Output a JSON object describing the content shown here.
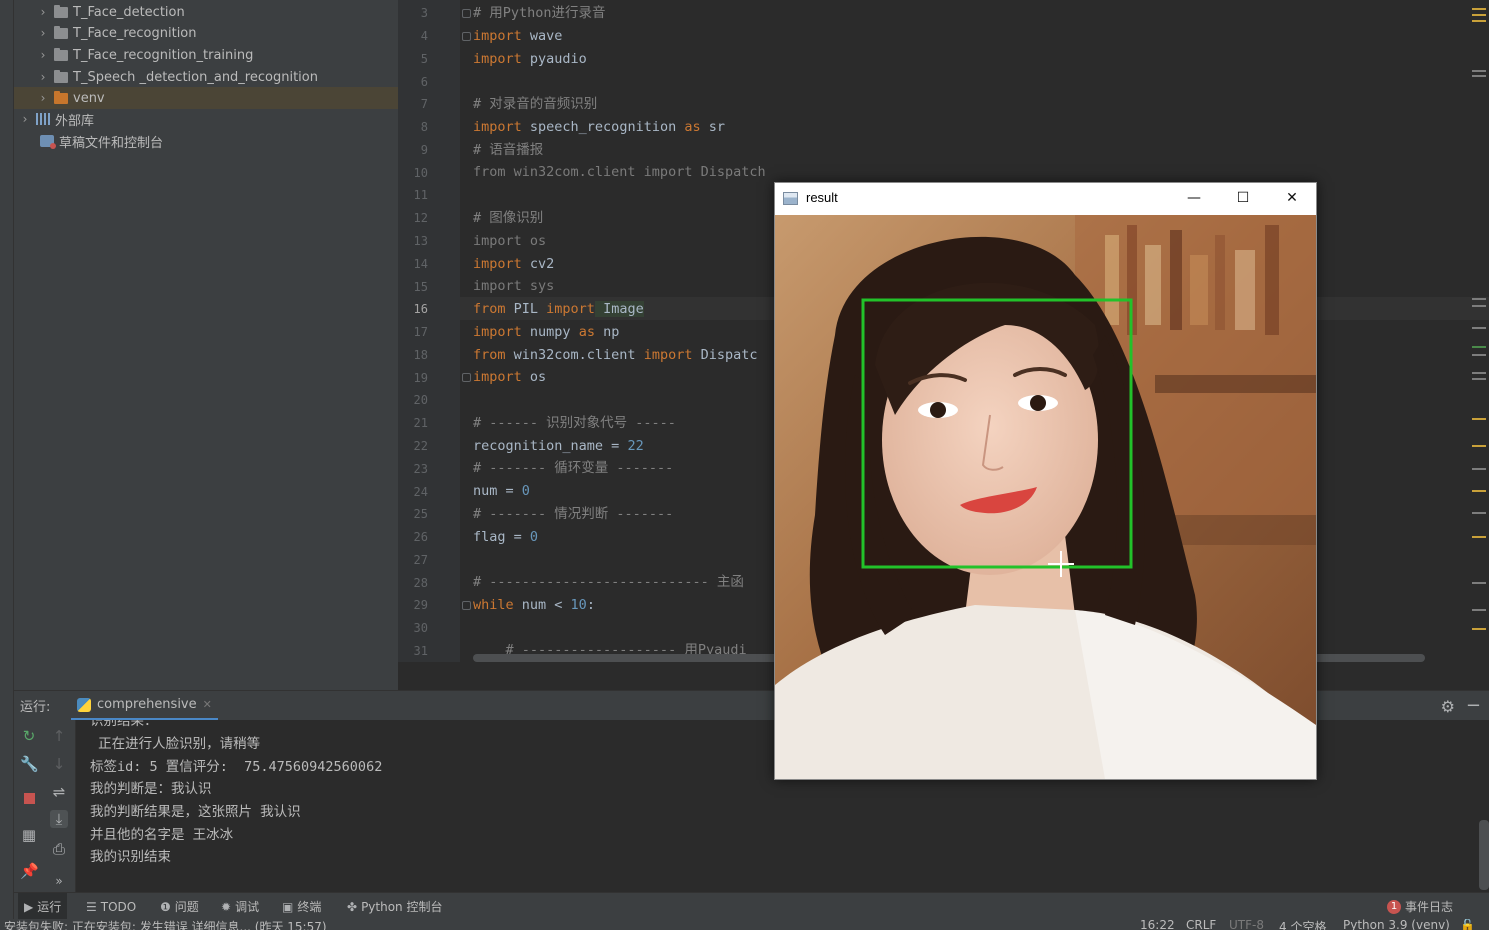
{
  "project_tree": {
    "items": [
      {
        "label": "T_Face_detection",
        "icon": "folder-icon"
      },
      {
        "label": "T_Face_recognition",
        "icon": "folder-icon"
      },
      {
        "label": "T_Face_recognition_training",
        "icon": "folder-icon"
      },
      {
        "label": "T_Speech _detection_and_recognition",
        "icon": "folder-icon"
      },
      {
        "label": "venv",
        "icon": "folder-orange-icon"
      },
      {
        "label": "外部库",
        "icon": "library-icon"
      },
      {
        "label": "草稿文件和控制台",
        "icon": "scratches-icon"
      }
    ]
  },
  "editor": {
    "line_numbers": [
      "3",
      "4",
      "5",
      "6",
      "7",
      "8",
      "9",
      "10",
      "11",
      "12",
      "13",
      "14",
      "15",
      "16",
      "17",
      "18",
      "19",
      "20",
      "21",
      "22",
      "23",
      "24",
      "25",
      "26",
      "27",
      "28",
      "29",
      "30",
      "31"
    ],
    "current_line": "16",
    "lines": {
      "l3": "# 用Python进行录音",
      "l4a": "import",
      "l4b": " wave",
      "l5a": "import",
      "l5b": " pyaudio",
      "l7": "# 对录音的音频识别",
      "l8a": "import",
      "l8b": " speech_recognition ",
      "l8c": "as",
      "l8d": " sr",
      "l9": "# 语音播报",
      "l10": "from win32com.client import Dispatch",
      "l12": "# 图像识别",
      "l13": "import os",
      "l14a": "import",
      "l14b": " cv2",
      "l15": "import sys",
      "l16a": "from",
      "l16b": " PIL ",
      "l16c": "import",
      "l16d": " Image",
      "l17a": "import",
      "l17b": " numpy ",
      "l17c": "as",
      "l17d": " np",
      "l18a": "from",
      "l18b": " win32com.client ",
      "l18c": "import",
      "l18d": " Dispatc",
      "l19a": "import",
      "l19b": " os",
      "l21": "# ------ 识别对象代号 -----",
      "l22a": "recognition_name = ",
      "l22b": "22",
      "l23": "# ------- 循环变量 -------",
      "l24a": "num = ",
      "l24b": "0",
      "l25": "# ------- 情况判断 -------",
      "l26a": "flag = ",
      "l26b": "0",
      "l28": "# --------------------------- 主函",
      "l29a": "while",
      "l29b": " num < ",
      "l29c": "10",
      "l29d": ":",
      "l31": "    # ------------------- 用Pyaudi"
    }
  },
  "run_panel": {
    "label": "运行:",
    "tab": "comprehensive",
    "console_lines": [
      "识别结果：",
      " 正在进行人脸识别，请稍等",
      "标签id: 5 置信评分:  75.47560942560062",
      "我的判断是：我认识",
      "我的判断结果是，这张照片 我认识",
      "并且他的名字是 王冰冰",
      "我的识别结束"
    ]
  },
  "bottom_bar": {
    "run": "运行",
    "todo": "TODO",
    "problems": "问题",
    "debug": "调试",
    "terminal": "终端",
    "python_console": "Python 控制台",
    "event_log": "事件日志",
    "event_count": "1"
  },
  "status_bar": {
    "message": "安装包失败: 正在安装包: 发生错误    详细信息...  (昨天 15:57)",
    "position": "16:22",
    "line_sep": "CRLF",
    "encoding": "UTF-8",
    "indent": "4 个空格",
    "interpreter": "Python 3.9 (venv)"
  },
  "result_window": {
    "title": "result",
    "minimize": "—",
    "maximize": "☐",
    "close": "✕"
  },
  "colors": {
    "detection_box": "#22c22a",
    "editor_bg": "#2b2b2b",
    "panel_bg": "#3c3f41",
    "keyword": "#cc7832",
    "comment": "#808080",
    "number": "#6897bb"
  }
}
